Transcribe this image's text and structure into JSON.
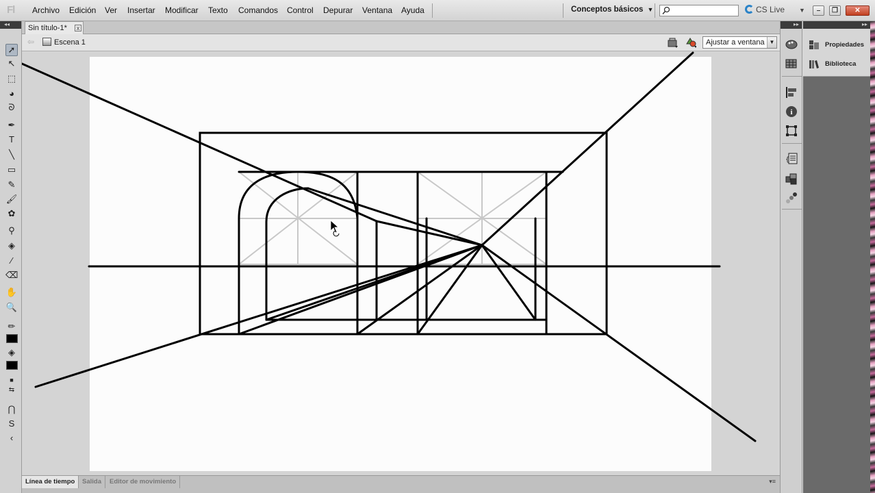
{
  "app": {
    "logo": "Fl"
  },
  "menu": [
    "Archivo",
    "Edición",
    "Ver",
    "Insertar",
    "Modificar",
    "Texto",
    "Comandos",
    "Control",
    "Depurar",
    "Ventana",
    "Ayuda"
  ],
  "workspace": {
    "label": "Conceptos básicos",
    "caret": "▼"
  },
  "search": {
    "placeholder": ""
  },
  "cslive": {
    "label": "CS Live",
    "caret": "▼"
  },
  "window": {
    "minimize": "–",
    "maximize": "❐",
    "close": "✕"
  },
  "document": {
    "tab_title": "Sin título-1*",
    "close": "x"
  },
  "editbar": {
    "scene_label": "Escena 1",
    "back": "⇦",
    "zoom_value": "Ajustar a ventana"
  },
  "bottom_tabs": [
    "Línea de tiempo",
    "Salida",
    "Editor de movimiento"
  ],
  "bottom_menu": "▾≡",
  "right_panel": {
    "items": [
      "Propiedades",
      "Biblioteca"
    ]
  },
  "panel_collapse": {
    "left": "◂◂",
    "right": "▸▸"
  },
  "colors": {
    "stroke": "#000000",
    "fill": "#000000",
    "stage": "#fcfcfc",
    "guide": "#c8c8c8"
  }
}
